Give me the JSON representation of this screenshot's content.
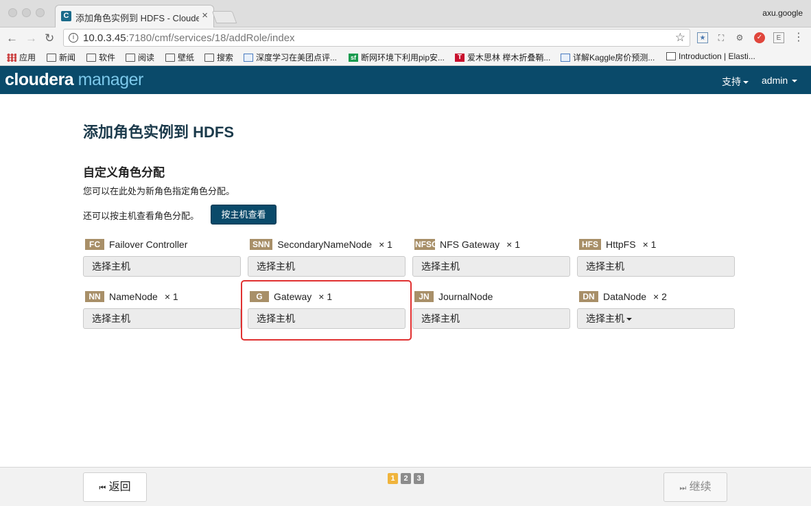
{
  "browser": {
    "tab_title": "添加角色实例到 HDFS - Cloudera",
    "favicon_letter": "C",
    "user": "axu.google",
    "url_host": "10.0.3.45",
    "url_path": ":7180/cmf/services/18/addRole/index"
  },
  "bookmarks": [
    {
      "label": "应用",
      "icon": "apps-grid-icon"
    },
    {
      "label": "新闻",
      "icon": "folder-icon"
    },
    {
      "label": "软件",
      "icon": "folder-icon"
    },
    {
      "label": "阅读",
      "icon": "folder-icon"
    },
    {
      "label": "壁纸",
      "icon": "folder-icon"
    },
    {
      "label": "搜索",
      "icon": "folder-icon"
    },
    {
      "label": "深度学习在美团点评...",
      "icon": "chart-favicon-icon"
    },
    {
      "label": "断网环境下利用pip安...",
      "icon": "sf-favicon-icon"
    },
    {
      "label": "爱木思林 榉木折叠鞘...",
      "icon": "t-favicon-icon"
    },
    {
      "label": "详解Kaggle房价预测...",
      "icon": "chart-favicon-icon"
    },
    {
      "label": "Introduction | Elasti...",
      "icon": "book-favicon-icon"
    }
  ],
  "header": {
    "logo_main": "cloudera",
    "logo_sub": "manager",
    "support_label": "支持",
    "user_label": "admin"
  },
  "page": {
    "title": "添加角色实例到 HDFS",
    "section_title": "自定义角色分配",
    "desc1": "您可以在此处为新角色指定角色分配。",
    "desc2": "还可以按主机查看角色分配。",
    "by_host_button": "按主机查看"
  },
  "roles": [
    {
      "abbr": "FC",
      "name": "Failover Controller",
      "mult": "",
      "select": "选择主机"
    },
    {
      "abbr": "SNN",
      "name": "SecondaryNameNode",
      "mult": "× 1",
      "select": "选择主机"
    },
    {
      "abbr": "NFSG",
      "name": "NFS Gateway",
      "mult": "× 1",
      "select": "选择主机"
    },
    {
      "abbr": "HFS",
      "name": "HttpFS",
      "mult": "× 1",
      "select": "选择主机"
    },
    {
      "abbr": "NN",
      "name": "NameNode",
      "mult": "× 1",
      "select": "选择主机"
    },
    {
      "abbr": "G",
      "name": "Gateway",
      "mult": "× 1",
      "select": "选择主机"
    },
    {
      "abbr": "JN",
      "name": "JournalNode",
      "mult": "",
      "select": "选择主机"
    },
    {
      "abbr": "DN",
      "name": "DataNode",
      "mult": "× 2",
      "select": "选择主机"
    }
  ],
  "footer": {
    "back_label": "返回",
    "continue_label": "继续",
    "steps": [
      "1",
      "2",
      "3"
    ],
    "current_step": "1",
    "step_active_color": "#f0b43c",
    "step_inactive_color": "#8c8c8c"
  },
  "colors": {
    "header_bg": "#0a4a6a",
    "badge_bg": "#a88f68",
    "highlight": "#e03030"
  }
}
